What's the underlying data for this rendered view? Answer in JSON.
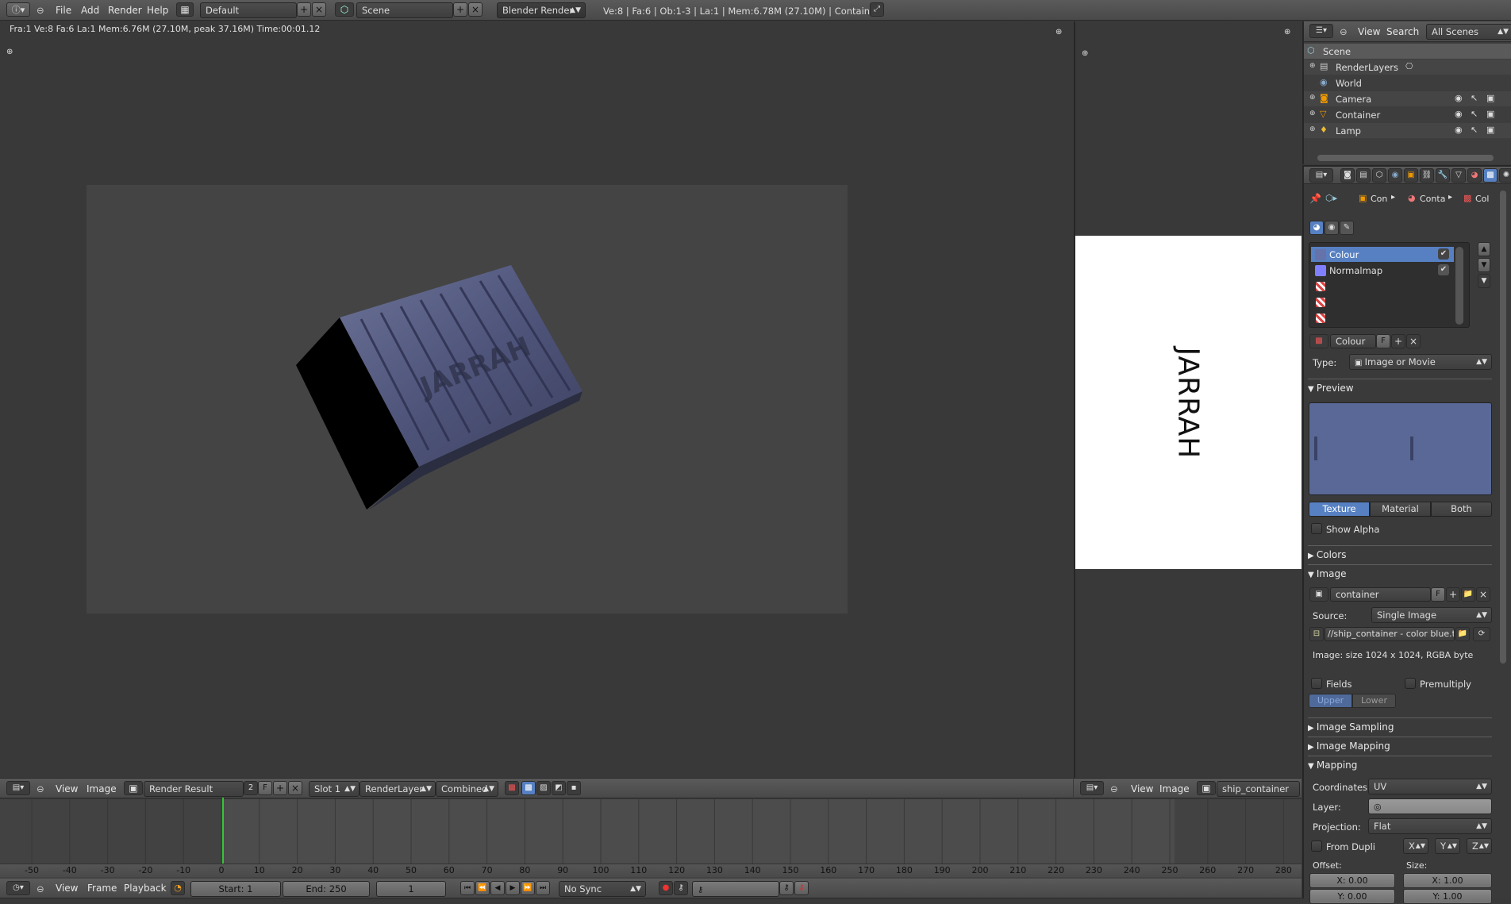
{
  "topbar": {
    "menus": [
      "File",
      "Add",
      "Render",
      "Help"
    ],
    "layout": "Default",
    "scene": "Scene",
    "engine": "Blender Render",
    "stats": "Ve:8 | Fa:6 | Ob:1-3 | La:1 | Mem:6.78M (27.10M) | Container"
  },
  "render_view": {
    "info": "Fra:1  Ve:8 Fa:6 La:1 Mem:6.76M (27.10M, peak 37.16M) Time:00:01.12",
    "texture_text": "JARRAH"
  },
  "image_preview": {
    "text": "JARRAH"
  },
  "left_image_header": {
    "menus": [
      "View",
      "Image"
    ],
    "image_name": "Render Result",
    "users": "2",
    "fake": "F",
    "slot": "Slot 1",
    "layer": "RenderLayer",
    "pass": "Combined"
  },
  "right_image_header": {
    "menus": [
      "View",
      "Image"
    ],
    "image_name": "ship_container"
  },
  "outliner": {
    "menus": [
      "View",
      "Search"
    ],
    "filter": "All Scenes",
    "items": [
      "Scene",
      "RenderLayers",
      "World",
      "Camera",
      "Container",
      "Lamp"
    ]
  },
  "properties": {
    "breadcrumb": [
      "Con",
      "Conta",
      "Col"
    ],
    "texture_slots": [
      "Colour",
      "Normalmap"
    ],
    "texture_name": "Colour",
    "fake": "F",
    "type_label": "Type:",
    "type_value": "Image or Movie",
    "preview": {
      "title": "Preview",
      "tabs": [
        "Texture",
        "Material",
        "Both"
      ],
      "show_alpha": "Show Alpha",
      "active_tab": "Texture"
    },
    "colors": "Colors",
    "image": {
      "title": "Image",
      "name": "container",
      "fake": "F",
      "source_label": "Source:",
      "source": "Single Image",
      "path": "//ship_container - color blue.tga",
      "info": "Image: size 1024 x 1024, RGBA byte",
      "fields": "Fields",
      "premultiply": "Premultiply",
      "upper": "Upper Firs",
      "lower": "Lower Firs"
    },
    "image_sampling": "Image Sampling",
    "image_mapping": "Image Mapping",
    "mapping": {
      "title": "Mapping",
      "coordinates_label": "Coordinates:",
      "coordinates": "UV",
      "layer_label": "Layer:",
      "projection_label": "Projection:",
      "projection": "Flat",
      "from_dupli": "From Dupli",
      "axes": [
        "X",
        "Y",
        "Z"
      ],
      "offset_label": "Offset:",
      "size_label": "Size:",
      "offset_x": "X: 0.00",
      "offset_y": "Y: 0.00",
      "size_x": "X: 1.00",
      "size_y": "Y: 1.00"
    }
  },
  "timeline": {
    "ruler": [
      "-50",
      "-40",
      "-30",
      "-20",
      "-10",
      "0",
      "10",
      "20",
      "30",
      "40",
      "50",
      "60",
      "70",
      "80",
      "90",
      "100",
      "110",
      "120",
      "130",
      "140",
      "150",
      "160",
      "170",
      "180",
      "190",
      "200",
      "210",
      "220",
      "230",
      "240",
      "250",
      "260",
      "270",
      "280"
    ],
    "menus": [
      "View",
      "Frame",
      "Playback"
    ],
    "start": "Start: 1",
    "end": "End: 250",
    "current": "1",
    "sync": "No Sync"
  },
  "colors": {
    "accent": "#5680c2",
    "bg": "#393939",
    "header": "#4f4f4f",
    "playhead": "#38c238",
    "preview_blue": "#5a6897"
  }
}
